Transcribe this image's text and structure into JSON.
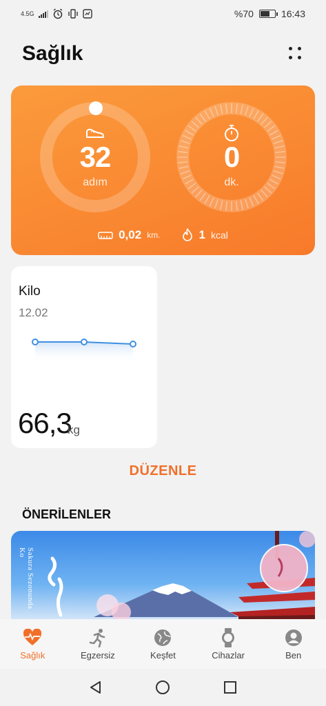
{
  "status_bar": {
    "network": "4.5G",
    "battery": "%70",
    "battery_level": 0.7,
    "time": "16:43"
  },
  "header": {
    "title": "Sağlık"
  },
  "activity": {
    "steps_value": "32",
    "steps_unit": "adım",
    "minutes_value": "0",
    "minutes_unit": "dk.",
    "distance_value": "0,02",
    "distance_unit": "km.",
    "calories_value": "1",
    "calories_unit": "kcal"
  },
  "weight_card": {
    "title": "Kilo",
    "date": "12.02",
    "value": "66,3",
    "unit": "kg"
  },
  "edit_label": "DÜZENLE",
  "recommended_title": "ÖNERİLENLER",
  "banner": {
    "side_text": "Sakura Sezonunda Ko"
  },
  "bottom_nav": {
    "items": [
      {
        "label": "Sağlık",
        "icon": "heart-pulse-icon",
        "active": true
      },
      {
        "label": "Egzersiz",
        "icon": "running-icon",
        "active": false
      },
      {
        "label": "Keşfet",
        "icon": "globe-icon",
        "active": false
      },
      {
        "label": "Cihazlar",
        "icon": "watch-icon",
        "active": false
      },
      {
        "label": "Ben",
        "icon": "person-icon",
        "active": false
      }
    ]
  },
  "colors": {
    "accent": "#f0702a",
    "card_orange_start": "#fb9b3c",
    "card_orange_end": "#f87a2a",
    "chart_line": "#3f8fe0"
  }
}
